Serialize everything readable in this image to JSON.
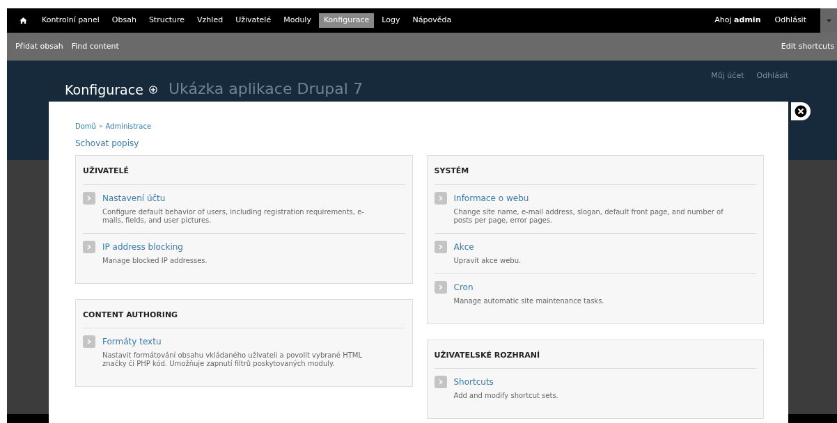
{
  "toolbar": {
    "items": [
      {
        "label": "Kontrolní panel",
        "selected": false
      },
      {
        "label": "Obsah",
        "selected": false
      },
      {
        "label": "Structure",
        "selected": false
      },
      {
        "label": "Vzhled",
        "selected": false
      },
      {
        "label": "Uživatelé",
        "selected": false
      },
      {
        "label": "Moduly",
        "selected": false
      },
      {
        "label": "Konfigurace",
        "selected": true
      },
      {
        "label": "Logy",
        "selected": false
      },
      {
        "label": "Nápověda",
        "selected": false
      }
    ],
    "greeting": "Ahoj **admin**",
    "logout": "Odhlásit"
  },
  "shortcuts": {
    "items": [
      "Přidat obsah",
      "Find content"
    ],
    "edit": "Edit shortcuts"
  },
  "header": {
    "page_title": "Konfigurace",
    "site_name": "Ukázka aplikace Drupal 7",
    "links": [
      "Můj účet",
      "Odhlásit"
    ]
  },
  "overlay": {
    "breadcrumb": [
      "Domů",
      "Administrace"
    ],
    "separator": "»",
    "toggle": "Schovat popisy",
    "columns": [
      [
        {
          "title": "UŽIVATELÉ",
          "items": [
            {
              "title": "Nastavení účtu",
              "description": "Configure default behavior of users, including registration requirements, e-mails, fields, and user pictures."
            },
            {
              "title": "IP address blocking",
              "description": "Manage blocked IP addresses."
            }
          ]
        },
        {
          "title": "CONTENT AUTHORING",
          "items": [
            {
              "title": "Formáty textu",
              "description": "Nastavit formátování obsahu vkládaného uživateli a povolit vybrané HTML značky či PHP kód. Umožňuje zapnutí filtrů poskytovaných moduly."
            }
          ]
        }
      ],
      [
        {
          "title": "SYSTÉM",
          "items": [
            {
              "title": "Informace o webu",
              "description": "Change site name, e-mail address, slogan, default front page, and number of posts per page, error pages."
            },
            {
              "title": "Akce",
              "description": "Upravit akce webu."
            },
            {
              "title": "Cron",
              "description": "Manage automatic site maintenance tasks."
            }
          ]
        },
        {
          "title": "UŽIVATELSKÉ ROZHRANÍ",
          "items": [
            {
              "title": "Shortcuts",
              "description": "Add and modify shortcut sets."
            }
          ]
        }
      ]
    ]
  }
}
